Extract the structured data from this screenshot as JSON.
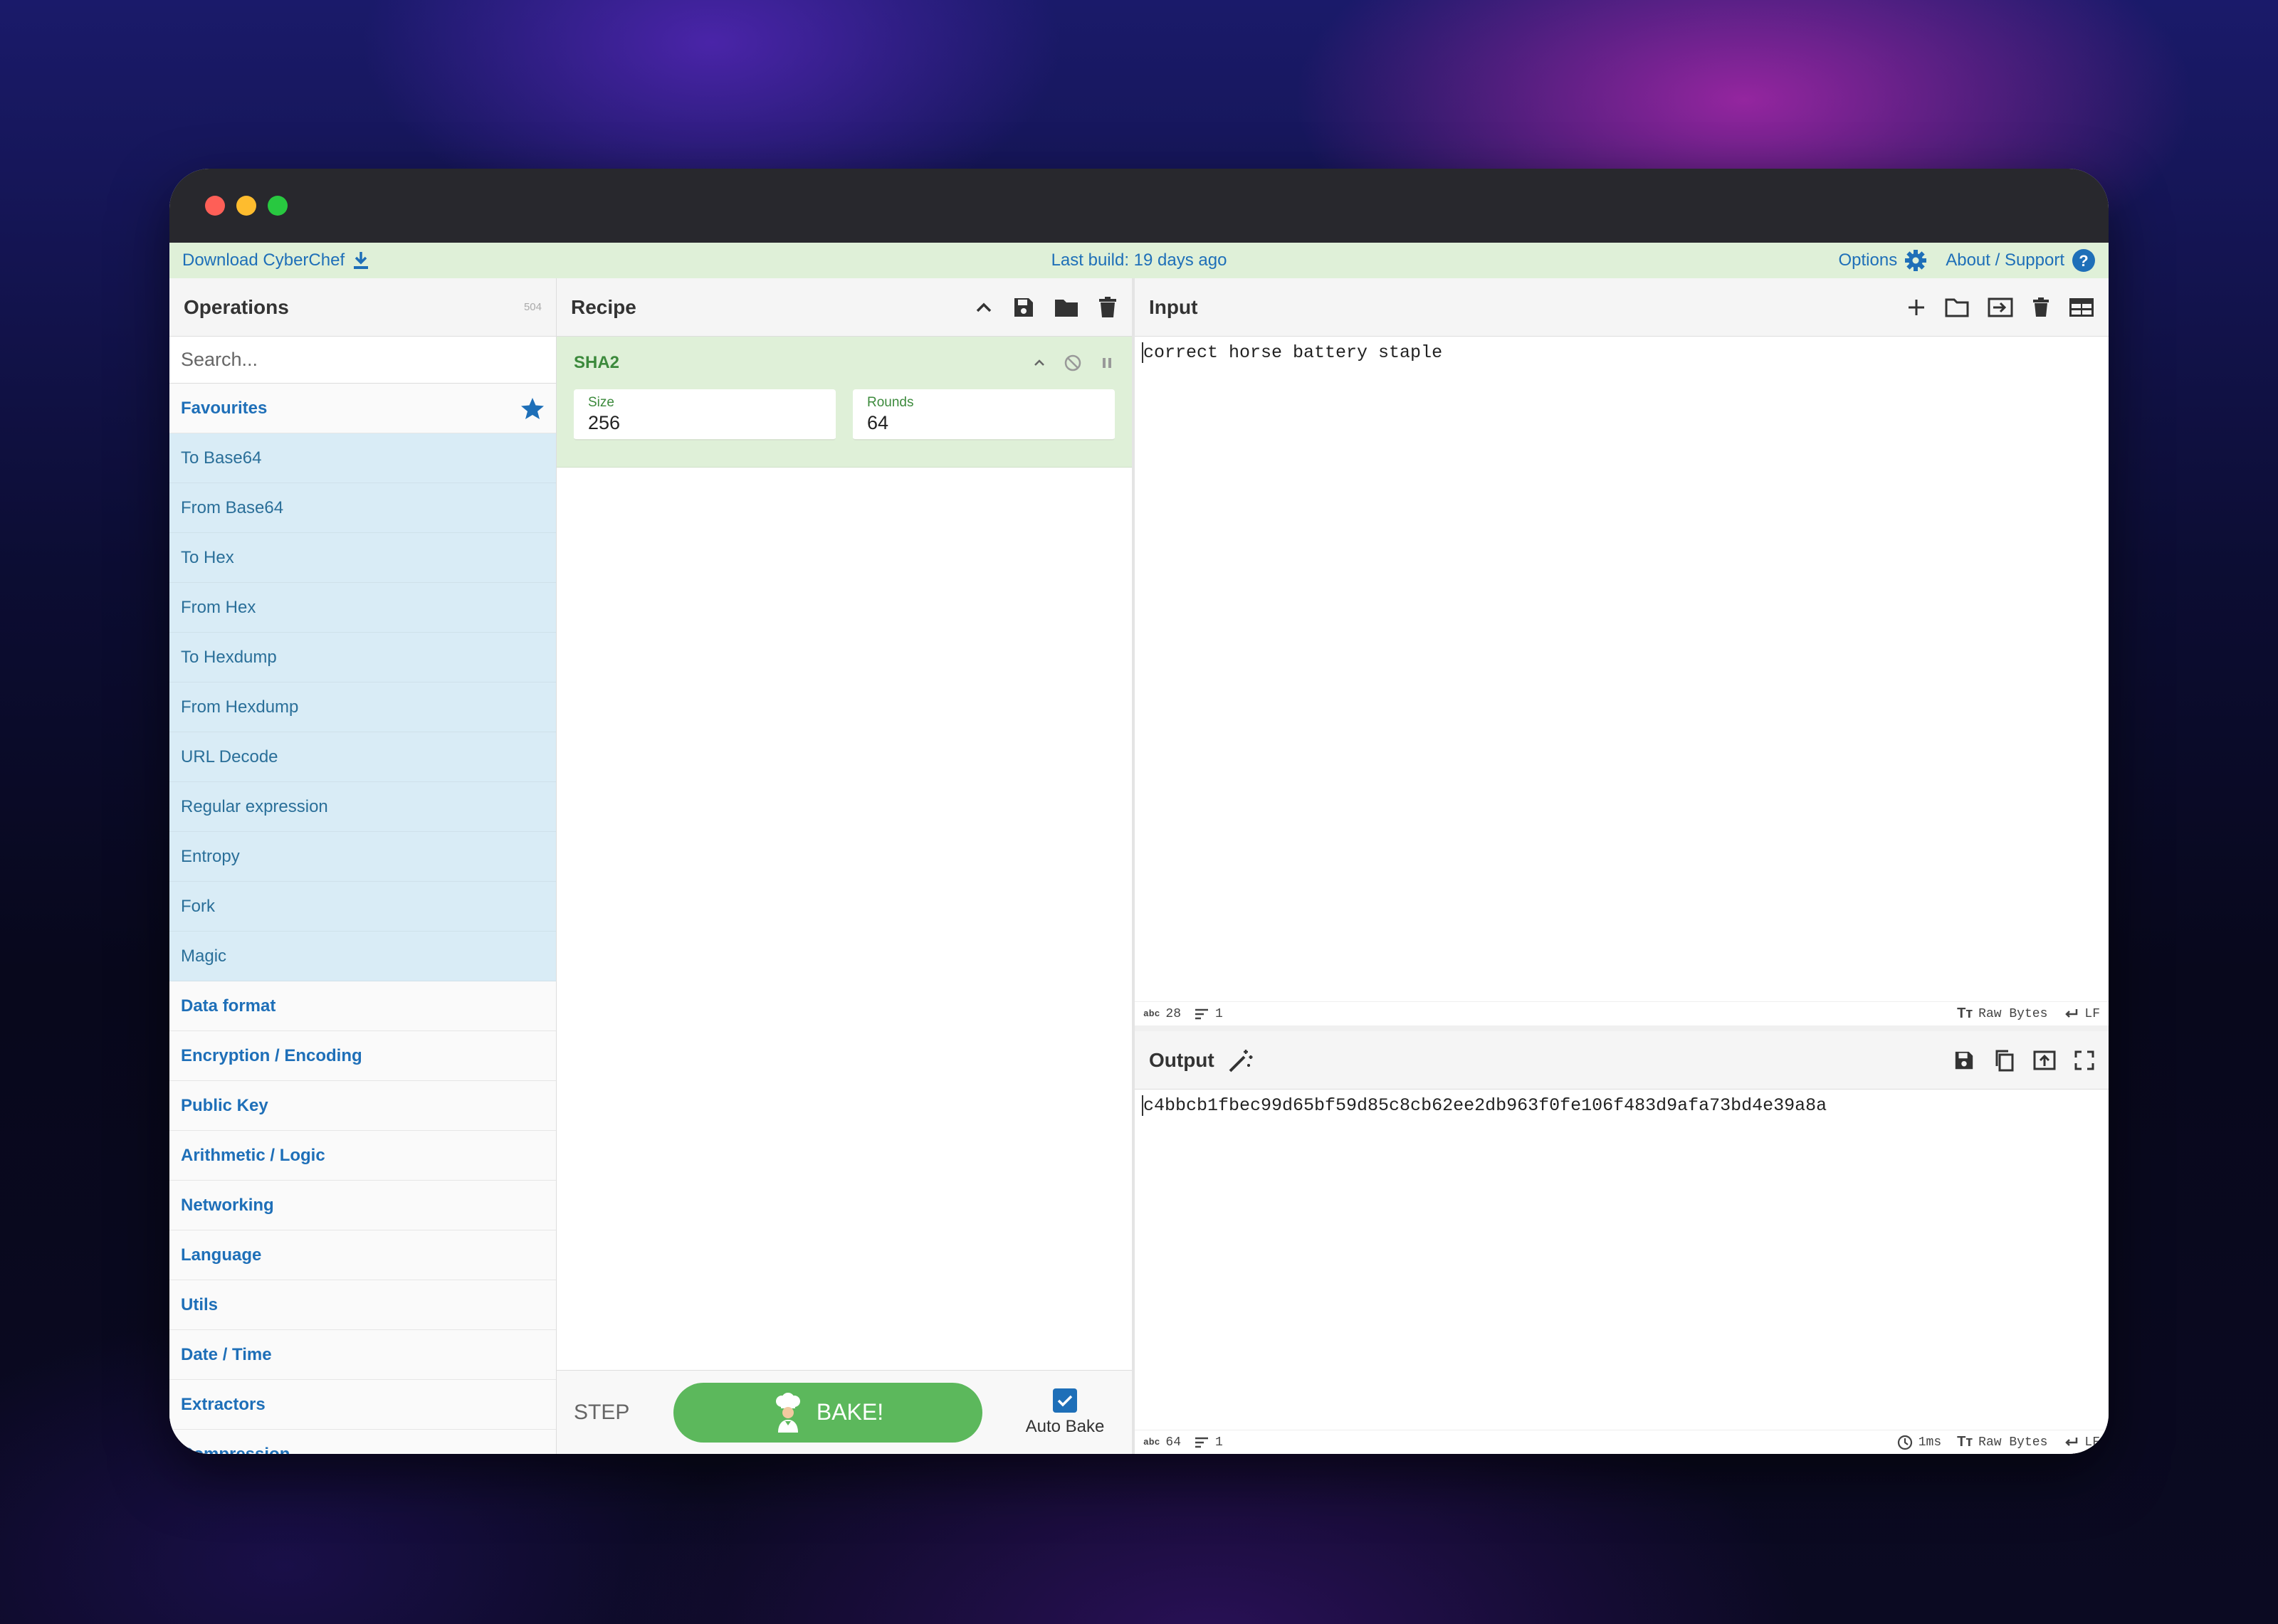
{
  "banner": {
    "download": "Download CyberChef",
    "last_build": "Last build: 19 days ago",
    "options": "Options",
    "about": "About / Support"
  },
  "operations": {
    "title": "Operations",
    "count": "504",
    "search_placeholder": "Search...",
    "favourites_label": "Favourites",
    "favourites": [
      "To Base64",
      "From Base64",
      "To Hex",
      "From Hex",
      "To Hexdump",
      "From Hexdump",
      "URL Decode",
      "Regular expression",
      "Entropy",
      "Fork",
      "Magic"
    ],
    "categories": [
      "Data format",
      "Encryption / Encoding",
      "Public Key",
      "Arithmetic / Logic",
      "Networking",
      "Language",
      "Utils",
      "Date / Time",
      "Extractors",
      "Compression"
    ]
  },
  "recipe": {
    "title": "Recipe",
    "ingredient": {
      "name": "SHA2",
      "args": [
        {
          "label": "Size",
          "value": "256"
        },
        {
          "label": "Rounds",
          "value": "64"
        }
      ]
    },
    "step_label": "STEP",
    "bake_label": "BAKE!",
    "auto_bake_label": "Auto Bake",
    "auto_bake_checked": true
  },
  "input": {
    "title": "Input",
    "text": "correct horse battery staple",
    "status": {
      "chars": "28",
      "lines": "1",
      "encoding": "Raw Bytes",
      "eol": "LF"
    }
  },
  "output": {
    "title": "Output",
    "text": "c4bbcb1fbec99d65bf59d85c8cb62ee2db963f0fe106f483d9afa73bd4e39a8a",
    "status": {
      "chars": "64",
      "lines": "1",
      "time": "1ms",
      "encoding": "Raw Bytes",
      "eol": "LF"
    }
  },
  "colors": {
    "accent": "#1e6fb8",
    "bake_green": "#5cb85c",
    "banner_bg": "#dff0d8",
    "favourite_bg": "#d9ecf6"
  }
}
